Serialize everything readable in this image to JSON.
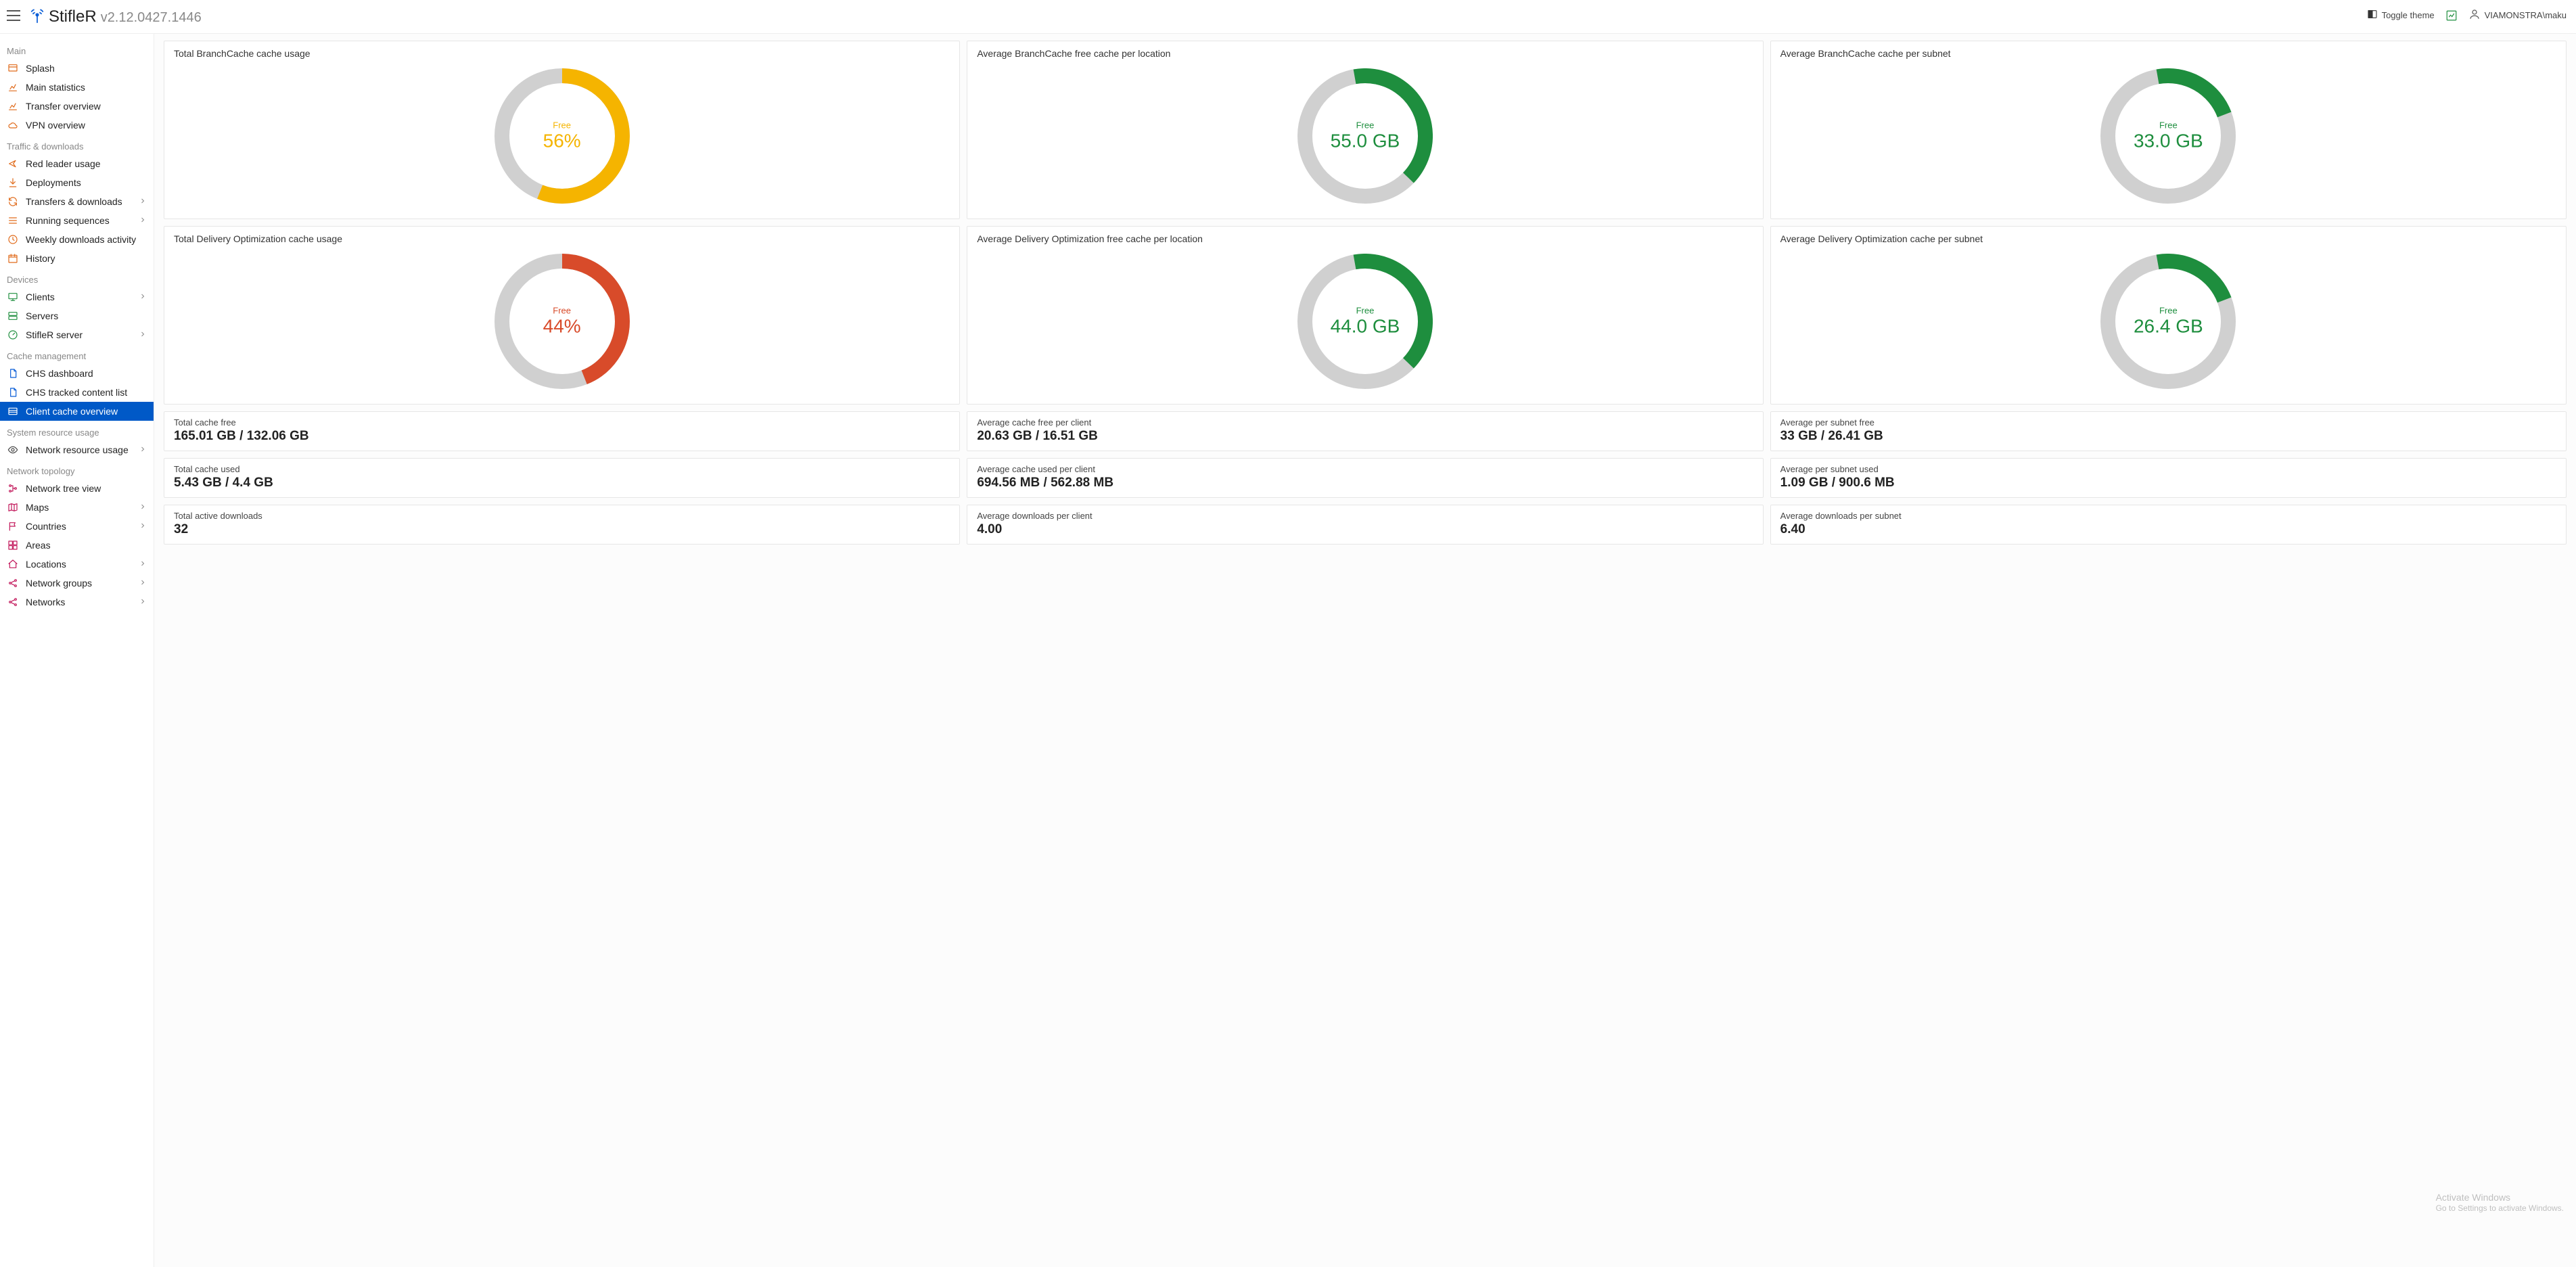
{
  "header": {
    "brand": "StifleR",
    "version": "v2.12.0427.1446",
    "toggle_theme": "Toggle theme",
    "user": "VIAMONSTRA\\maku"
  },
  "sidebar": {
    "sections": [
      {
        "title": "Main",
        "items": [
          {
            "id": "splash",
            "label": "Splash",
            "icon": "splash",
            "chev": false
          },
          {
            "id": "main-statistics",
            "label": "Main statistics",
            "icon": "stats",
            "chev": false
          },
          {
            "id": "transfer-overview",
            "label": "Transfer overview",
            "icon": "transfer",
            "chev": false
          },
          {
            "id": "vpn-overview",
            "label": "VPN overview",
            "icon": "cloud",
            "chev": false
          }
        ]
      },
      {
        "title": "Traffic & downloads",
        "items": [
          {
            "id": "red-leader-usage",
            "label": "Red leader usage",
            "icon": "arrow",
            "chev": false
          },
          {
            "id": "deployments",
            "label": "Deployments",
            "icon": "download",
            "chev": false
          },
          {
            "id": "transfers-downloads",
            "label": "Transfers & downloads",
            "icon": "refresh",
            "chev": true
          },
          {
            "id": "running-sequences",
            "label": "Running sequences",
            "icon": "list",
            "chev": true
          },
          {
            "id": "weekly-downloads-activity",
            "label": "Weekly downloads activity",
            "icon": "clock",
            "chev": false
          },
          {
            "id": "history",
            "label": "History",
            "icon": "calendar",
            "chev": false
          }
        ]
      },
      {
        "title": "Devices",
        "items": [
          {
            "id": "clients",
            "label": "Clients",
            "icon": "monitor",
            "chev": true
          },
          {
            "id": "servers",
            "label": "Servers",
            "icon": "server",
            "chev": false
          },
          {
            "id": "stifler-server",
            "label": "StifleR server",
            "icon": "gauge",
            "chev": true
          }
        ]
      },
      {
        "title": "Cache management",
        "items": [
          {
            "id": "chs-dashboard",
            "label": "CHS dashboard",
            "icon": "doc",
            "chev": false
          },
          {
            "id": "chs-tracked",
            "label": "CHS tracked content list",
            "icon": "doc",
            "chev": false
          },
          {
            "id": "client-cache-overview",
            "label": "Client cache overview",
            "icon": "rows",
            "chev": false,
            "active": true
          }
        ]
      },
      {
        "title": "System resource usage",
        "items": [
          {
            "id": "network-resource-usage",
            "label": "Network resource usage",
            "icon": "eye",
            "chev": true
          }
        ]
      },
      {
        "title": "Network topology",
        "items": [
          {
            "id": "network-tree-view",
            "label": "Network tree view",
            "icon": "tree",
            "chev": false
          },
          {
            "id": "maps",
            "label": "Maps",
            "icon": "map",
            "chev": true
          },
          {
            "id": "countries",
            "label": "Countries",
            "icon": "flag",
            "chev": true
          },
          {
            "id": "areas",
            "label": "Areas",
            "icon": "grid",
            "chev": false
          },
          {
            "id": "locations",
            "label": "Locations",
            "icon": "home",
            "chev": true
          },
          {
            "id": "network-groups",
            "label": "Network groups",
            "icon": "share",
            "chev": true
          },
          {
            "id": "networks",
            "label": "Networks",
            "icon": "share",
            "chev": true
          }
        ]
      }
    ]
  },
  "gauges": [
    {
      "title": "Total BranchCache cache usage",
      "label": "Free",
      "value": "56%",
      "pct": 56,
      "color": "#f5b400",
      "start": 0,
      "dir": 1
    },
    {
      "title": "Average BranchCache free cache per location",
      "label": "Free",
      "value": "55.0 GB",
      "pct": 40,
      "color": "#1e8e3e",
      "start": -10,
      "dir": 1
    },
    {
      "title": "Average BranchCache cache per subnet",
      "label": "Free",
      "value": "33.0 GB",
      "pct": 22,
      "color": "#1e8e3e",
      "start": -10,
      "dir": 1
    },
    {
      "title": "Total Delivery Optimization cache usage",
      "label": "Free",
      "value": "44%",
      "pct": 44,
      "color": "#d84b2a",
      "start": 0,
      "dir": 1
    },
    {
      "title": "Average Delivery Optimization free cache per location",
      "label": "Free",
      "value": "44.0 GB",
      "pct": 40,
      "color": "#1e8e3e",
      "start": -10,
      "dir": 1
    },
    {
      "title": "Average Delivery Optimization cache per subnet",
      "label": "Free",
      "value": "26.4 GB",
      "pct": 22,
      "color": "#1e8e3e",
      "start": -10,
      "dir": 1
    }
  ],
  "stats": [
    {
      "label": "Total cache free",
      "value": "165.01 GB / 132.06 GB"
    },
    {
      "label": "Average cache free per client",
      "value": "20.63 GB / 16.51 GB"
    },
    {
      "label": "Average per subnet free",
      "value": "33 GB / 26.41 GB"
    },
    {
      "label": "Total cache used",
      "value": "5.43 GB / 4.4 GB"
    },
    {
      "label": "Average cache used per client",
      "value": "694.56 MB / 562.88 MB"
    },
    {
      "label": "Average per subnet used",
      "value": "1.09 GB / 900.6 MB"
    },
    {
      "label": "Total active downloads",
      "value": "32"
    },
    {
      "label": "Average downloads per client",
      "value": "4.00"
    },
    {
      "label": "Average downloads per subnet",
      "value": "6.40"
    }
  ],
  "chart_data": [
    {
      "type": "pie",
      "segment": "free",
      "percent": 56,
      "title": "Total BranchCache cache usage",
      "color": "#f5b400"
    },
    {
      "type": "pie",
      "segment": "free",
      "percent": 40,
      "title": "Average BranchCache free cache per location",
      "value_gb": 55.0,
      "color": "#1e8e3e"
    },
    {
      "type": "pie",
      "segment": "free",
      "percent": 22,
      "title": "Average BranchCache cache per subnet",
      "value_gb": 33.0,
      "color": "#1e8e3e"
    },
    {
      "type": "pie",
      "segment": "free",
      "percent": 44,
      "title": "Total Delivery Optimization cache usage",
      "color": "#d84b2a"
    },
    {
      "type": "pie",
      "segment": "free",
      "percent": 40,
      "title": "Average Delivery Optimization free cache per location",
      "value_gb": 44.0,
      "color": "#1e8e3e"
    },
    {
      "type": "pie",
      "segment": "free",
      "percent": 22,
      "title": "Average Delivery Optimization cache per subnet",
      "value_gb": 26.4,
      "color": "#1e8e3e"
    }
  ],
  "watermark": {
    "line1": "Activate Windows",
    "line2": "Go to Settings to activate Windows."
  }
}
